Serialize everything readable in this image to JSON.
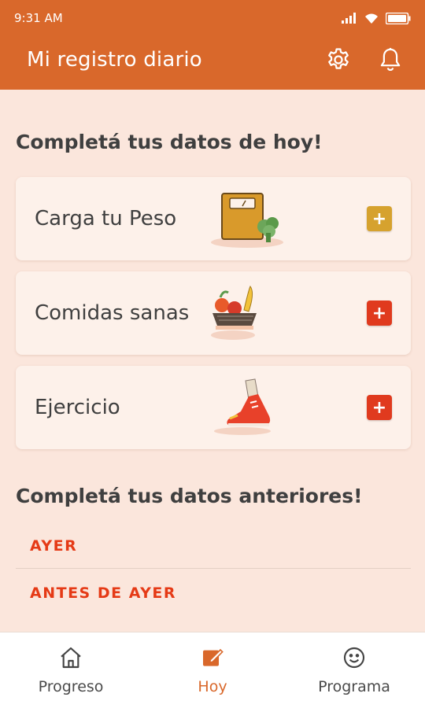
{
  "status_bar": {
    "time": "9:31 AM"
  },
  "app_bar": {
    "title": "Mi registro diario",
    "background": "#d9682b",
    "actions": [
      {
        "icon": "gear-icon"
      },
      {
        "icon": "bell-icon"
      }
    ]
  },
  "today_section": {
    "heading": "Completá tus datos de hoy!",
    "cards": [
      {
        "label": "Carga tu Peso",
        "illustration": "scale-broccoli-icon",
        "button_symbol": "+",
        "button_color": "#d6a22e"
      },
      {
        "label": "Comidas sanas",
        "illustration": "food-bowl-icon",
        "button_symbol": "+",
        "button_color": "#e03a1e"
      },
      {
        "label": "Ejercicio",
        "illustration": "sneaker-icon",
        "button_symbol": "+",
        "button_color": "#e03a1e"
      }
    ]
  },
  "previous_section": {
    "heading": "Completá tus datos anteriores!",
    "rows": [
      {
        "label": "AYER"
      },
      {
        "label": "ANTES DE AYER"
      }
    ]
  },
  "bottom_nav": {
    "items": [
      {
        "label": "Progreso",
        "icon": "home-icon",
        "active": false
      },
      {
        "label": "Hoy",
        "icon": "edit-note-icon",
        "active": true
      },
      {
        "label": "Programa",
        "icon": "smiley-icon",
        "active": false
      }
    ],
    "active_color": "#d9682b"
  }
}
